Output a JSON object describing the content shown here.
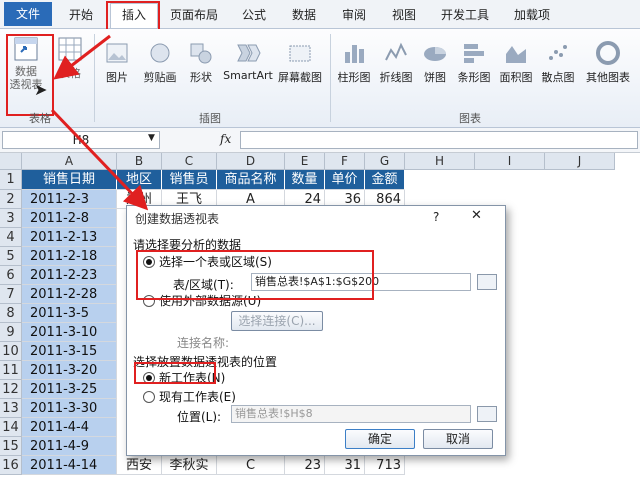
{
  "ribbon_tabs": [
    "文件",
    "开始",
    "插入",
    "页面布局",
    "公式",
    "数据",
    "审阅",
    "视图",
    "开发工具",
    "加载项"
  ],
  "ribbon_groups": {
    "table": {
      "label": "表格",
      "buttons": [
        "数据\n透视表",
        "表格"
      ]
    },
    "illustrations": {
      "label": "插图",
      "buttons": [
        "图片",
        "剪贴画",
        "形状",
        "SmartArt",
        "屏幕截图"
      ]
    },
    "charts": {
      "label": "图表",
      "buttons": [
        "柱形图",
        "折线图",
        "饼图",
        "条形图",
        "面积图",
        "散点图",
        "其他图表"
      ]
    }
  },
  "formula_bar": {
    "name_box": "H8",
    "fx": "fx"
  },
  "columns": [
    "A",
    "B",
    "C",
    "D",
    "E",
    "F",
    "G",
    "H",
    "I",
    "J"
  ],
  "rows": [
    "1",
    "2",
    "3",
    "4",
    "5",
    "6",
    "7",
    "8",
    "9",
    "10",
    "11",
    "12",
    "13",
    "14",
    "15",
    "16"
  ],
  "table_headers": [
    "销售日期",
    "地区",
    "销售员",
    "商品名称",
    "数量",
    "单价",
    "金额"
  ],
  "row2": [
    "2011-2-3",
    "郑州",
    "王飞",
    "A",
    "24",
    "36",
    "864"
  ],
  "dates": [
    "2011-2-3",
    "2011-2-8",
    "2011-2-13",
    "2011-2-18",
    "2011-2-23",
    "2011-2-28",
    "2011-3-5",
    "2011-3-10",
    "2011-3-15",
    "2011-3-20",
    "2011-3-25",
    "2011-3-30",
    "2011-4-4",
    "2011-4-9",
    "2011-4-14"
  ],
  "row16": [
    "西安",
    "李秋实",
    "C",
    "23",
    "31",
    "713"
  ],
  "dialog": {
    "title": "创建数据透视表",
    "help": "?",
    "close": "✕",
    "section1": "请选择要分析的数据",
    "opt_select_range": "选择一个表或区域(S)",
    "range_label": "表/区域(T):",
    "range_value": "销售总表!$A$1:$G$200",
    "opt_external": "使用外部数据源(U)",
    "choose_conn_btn": "选择连接(C)...",
    "conn_name_label": "连接名称:",
    "section2": "选择放置数据透视表的位置",
    "opt_new_sheet": "新工作表(N)",
    "opt_existing_sheet": "现有工作表(E)",
    "location_label": "位置(L):",
    "location_value": "销售总表!$H$8",
    "ok": "确定",
    "cancel": "取消"
  },
  "colors": {
    "accent_red": "#e02020",
    "header_blue": "#1f5f9c",
    "date_blue": "#b8d0ee"
  }
}
